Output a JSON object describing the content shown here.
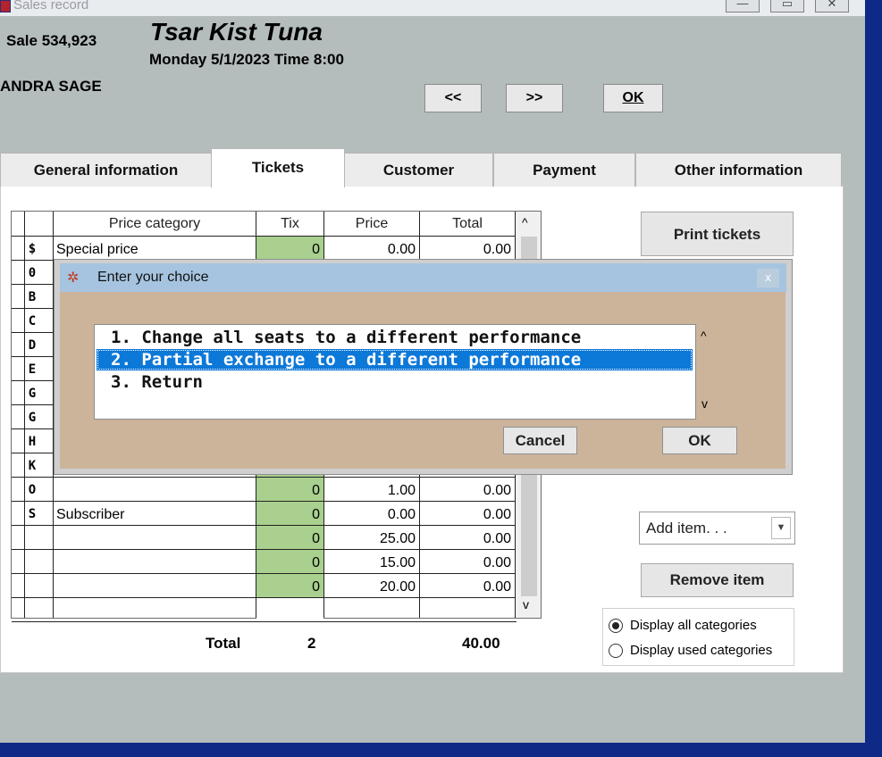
{
  "window": {
    "title": "Sales record"
  },
  "titlebar_buttons": {
    "minimize": "—",
    "maximize": "▭",
    "close": "✕"
  },
  "header": {
    "sale_number": "Sale 534,923",
    "event_title": "Tsar Kist Tuna",
    "event_date": "Monday 5/1/2023  Time 8:00",
    "customer": "ANDRA SAGE"
  },
  "nav": {
    "prev": "<<",
    "next": ">>",
    "ok": "OK"
  },
  "tabs": [
    {
      "label": "General information"
    },
    {
      "label": "Tickets"
    },
    {
      "label": "Customer"
    },
    {
      "label": "Payment"
    },
    {
      "label": "Other information"
    }
  ],
  "grid": {
    "columns": [
      "Price category",
      "Tix",
      "Price",
      "Total"
    ],
    "rows": [
      {
        "code": "$",
        "category": "Special price",
        "tix": "0",
        "price": "0.00",
        "total": "0.00"
      },
      {
        "code": "0",
        "category": "",
        "tix": "",
        "price": "",
        "total": ""
      },
      {
        "code": "B",
        "category": "",
        "tix": "",
        "price": "",
        "total": ""
      },
      {
        "code": "C",
        "category": "",
        "tix": "",
        "price": "",
        "total": ""
      },
      {
        "code": "D",
        "category": "",
        "tix": "",
        "price": "",
        "total": ""
      },
      {
        "code": "E",
        "category": "",
        "tix": "",
        "price": "",
        "total": ""
      },
      {
        "code": "G",
        "category": "",
        "tix": "",
        "price": "",
        "total": ""
      },
      {
        "code": "G",
        "category": "",
        "tix": "",
        "price": "",
        "total": ""
      },
      {
        "code": "H",
        "category": "",
        "tix": "",
        "price": "",
        "total": ""
      },
      {
        "code": "K",
        "category": "",
        "tix": "",
        "price": "",
        "total": ""
      },
      {
        "code": "O",
        "category": "",
        "tix": "0",
        "price": "1.00",
        "total": "0.00"
      },
      {
        "code": "S",
        "category": "Subscriber",
        "tix": "0",
        "price": "0.00",
        "total": "0.00"
      },
      {
        "code": "",
        "category": "",
        "tix": "0",
        "price": "25.00",
        "total": "0.00"
      },
      {
        "code": "",
        "category": "",
        "tix": "0",
        "price": "15.00",
        "total": "0.00"
      },
      {
        "code": "",
        "category": "",
        "tix": "0",
        "price": "20.00",
        "total": "0.00"
      },
      {
        "code": "",
        "category": "",
        "tix": "",
        "price": "",
        "total": ""
      }
    ],
    "scroll_up": "^",
    "scroll_down": "v"
  },
  "totals": {
    "label": "Total",
    "tix": "2",
    "amount": "40.00"
  },
  "side": {
    "print_tickets": "Print tickets",
    "add_item": "Add item. . .",
    "remove_item": "Remove item",
    "display_all": "Display all categories",
    "display_used": "Display used categories"
  },
  "dialog": {
    "title": "Enter your choice",
    "close": "x",
    "options": [
      "1. Change all seats to a different performance",
      "2. Partial exchange to a different performance",
      "3. Return"
    ],
    "scroll_up": "^",
    "scroll_down": "v",
    "cancel": "Cancel",
    "ok": "OK"
  },
  "colors": {
    "window_bg": "#b4bcbc",
    "frame_blue": "#0e2a86",
    "tix_green": "#a9d08e",
    "dialog_title": "#a6c4df",
    "dialog_body": "#ccb49b",
    "selection": "#0c78d8"
  }
}
